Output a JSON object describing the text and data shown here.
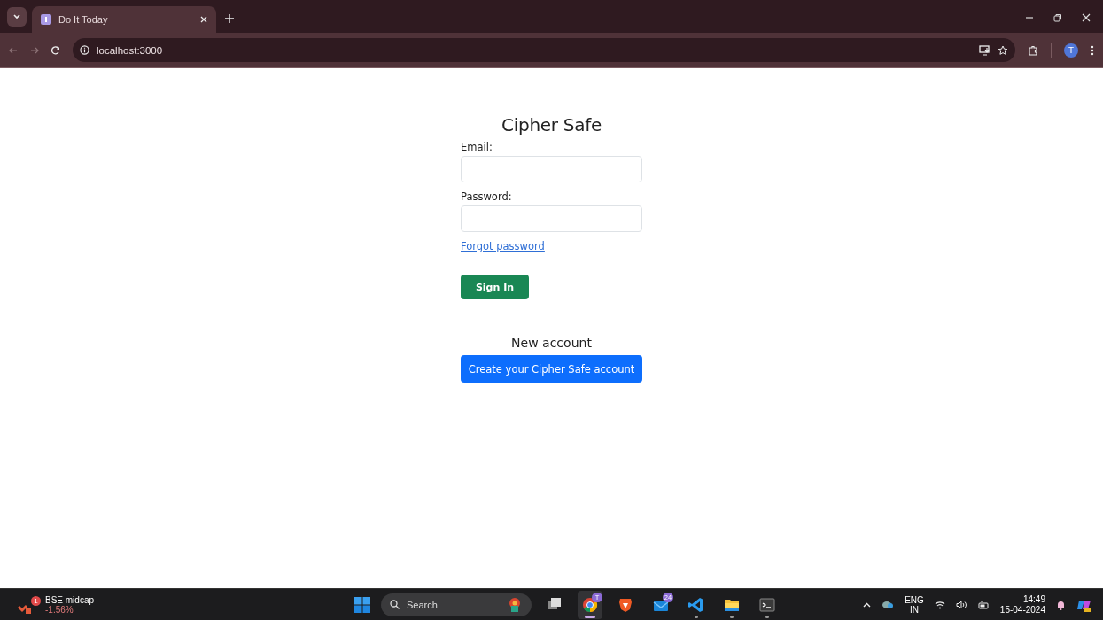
{
  "browser": {
    "tabs": [
      {
        "title": "Do It Today",
        "selected": true
      }
    ],
    "address": "localhost:3000",
    "profile_initial": "T"
  },
  "page": {
    "title": "Cipher Safe",
    "fields": [
      {
        "label": "Email:"
      },
      {
        "label": "Password:"
      }
    ],
    "forgot_link": "Forgot password",
    "sign_in_button": "Sign In",
    "new_account_heading": "New account",
    "create_button": "Create your Cipher Safe account"
  },
  "taskbar": {
    "widget": {
      "title": "BSE midcap",
      "change": "-1.56%",
      "badge": "1"
    },
    "search_placeholder": "Search",
    "apps": [
      {
        "kind": "taskview",
        "running": false,
        "selected": false
      },
      {
        "kind": "chrome",
        "badge": "T",
        "running": true,
        "selected": true
      },
      {
        "kind": "brave",
        "running": false,
        "selected": false
      },
      {
        "kind": "mail",
        "badge": "24",
        "running": false,
        "selected": false
      },
      {
        "kind": "vscode",
        "running": true,
        "selected": false
      },
      {
        "kind": "explorer",
        "running": true,
        "selected": false
      },
      {
        "kind": "terminal",
        "running": true,
        "selected": false
      }
    ],
    "language": "ENG",
    "region": "IN",
    "time": "14:49",
    "date": "15-04-2024"
  }
}
